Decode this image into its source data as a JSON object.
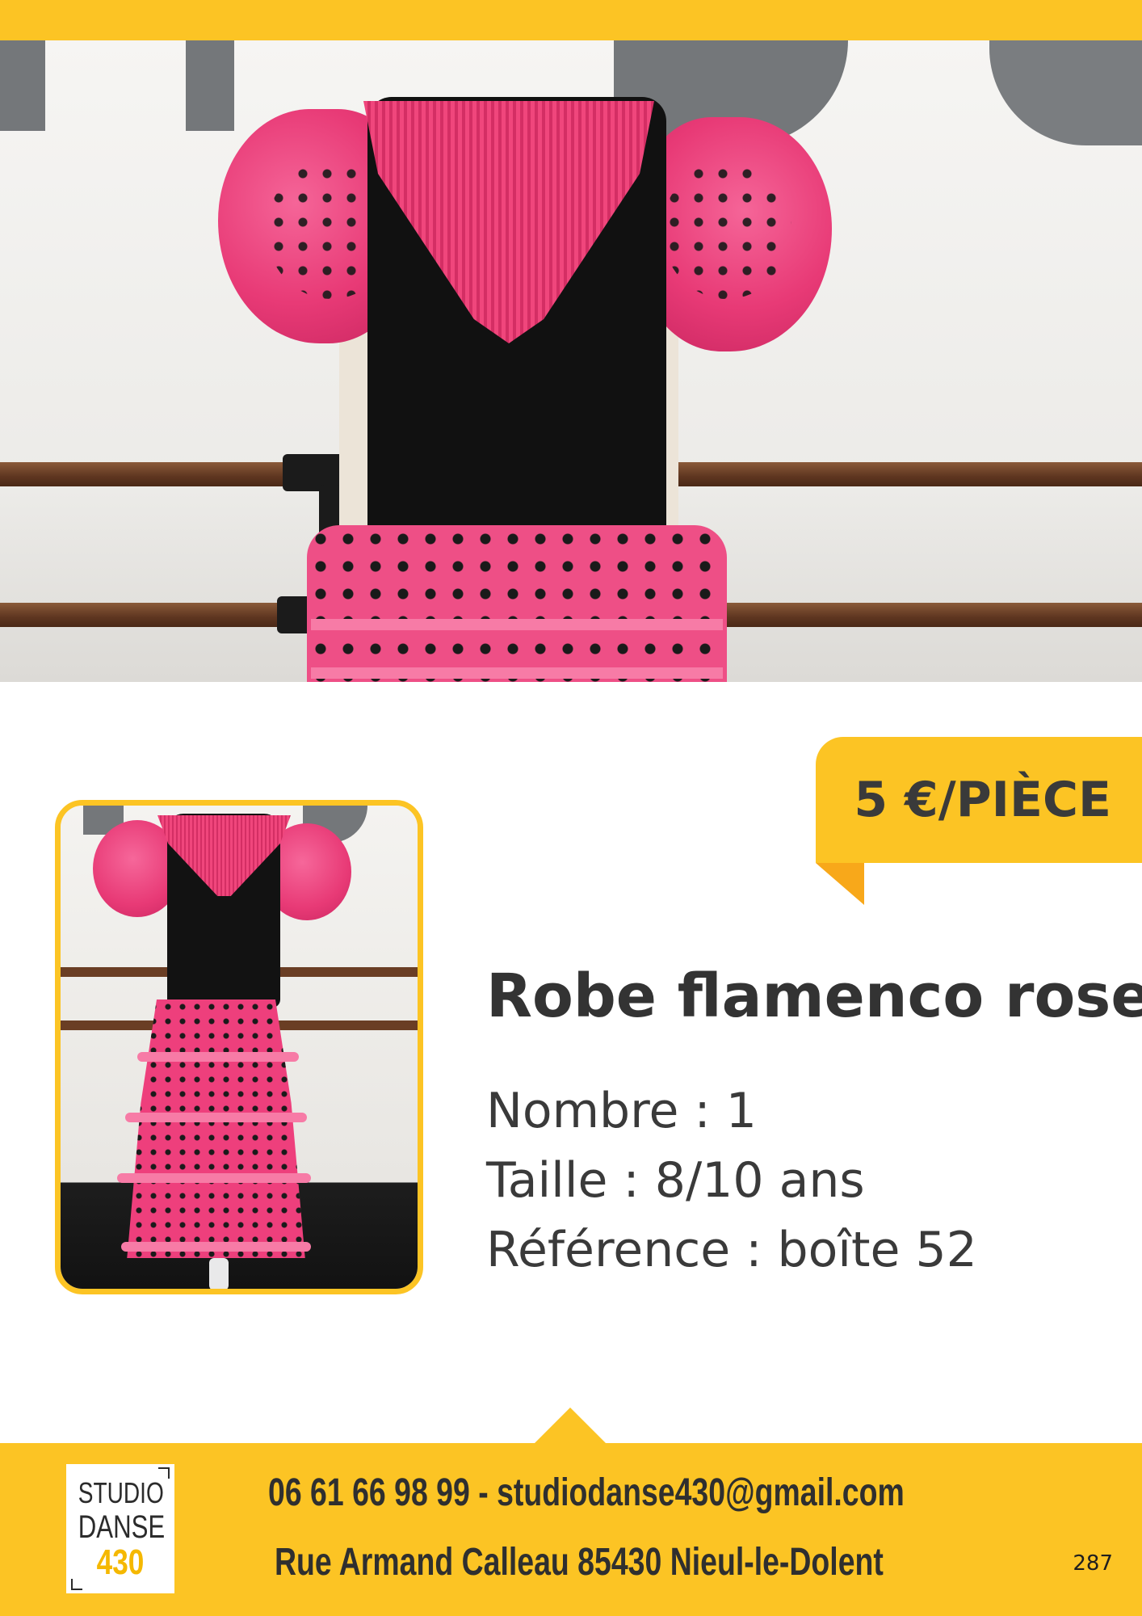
{
  "price": {
    "label": "5 €/PIÈCE"
  },
  "product": {
    "title": "Robe flamenco rose",
    "count": "Nombre : 1",
    "size": "Taille : 8/10 ans",
    "reference": "Référence : boîte 52"
  },
  "footer": {
    "logo": {
      "line1": "STUDIO",
      "line2": "DANSE",
      "line3": "430"
    },
    "contact": "06 61 66 98 99 - studiodanse430@gmail.com",
    "address": "Rue Armand Calleau 85430 Nieul-le-Dolent",
    "page_number": "287"
  },
  "colors": {
    "accent_yellow": "#fcc424",
    "fold_orange": "#f8a81a",
    "text_dark": "#333333",
    "dress_pink": "#ee4f86",
    "dress_black": "#111111"
  }
}
